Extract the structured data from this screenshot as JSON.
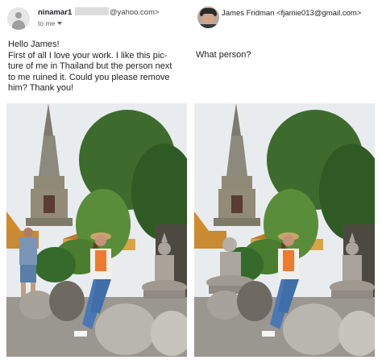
{
  "left": {
    "sender": {
      "name": "ninamar1",
      "email_domain": "@yahoo.com>",
      "to": "to me",
      "avatar_icon": "default-user-icon"
    },
    "message": {
      "line1": "Hello James!",
      "line2": "First of all I love your  work. I like  this pic-",
      "line3": "ture of me in Thailand but the person next",
      "line4": "to me ruined it.  Could you please remove",
      "line5": "him? Thank you!"
    }
  },
  "right": {
    "sender": {
      "name_email": "James Fridman <fjamie013@gmail.com>",
      "avatar_icon": "james-avatar"
    },
    "reply": "What person?"
  },
  "colors": {
    "sky": "#e9ecef",
    "foliage": "#3d6b2d",
    "pagoda": "#8c8a7c",
    "jeans": "#4a78b5",
    "statue": "#a9a39a"
  }
}
